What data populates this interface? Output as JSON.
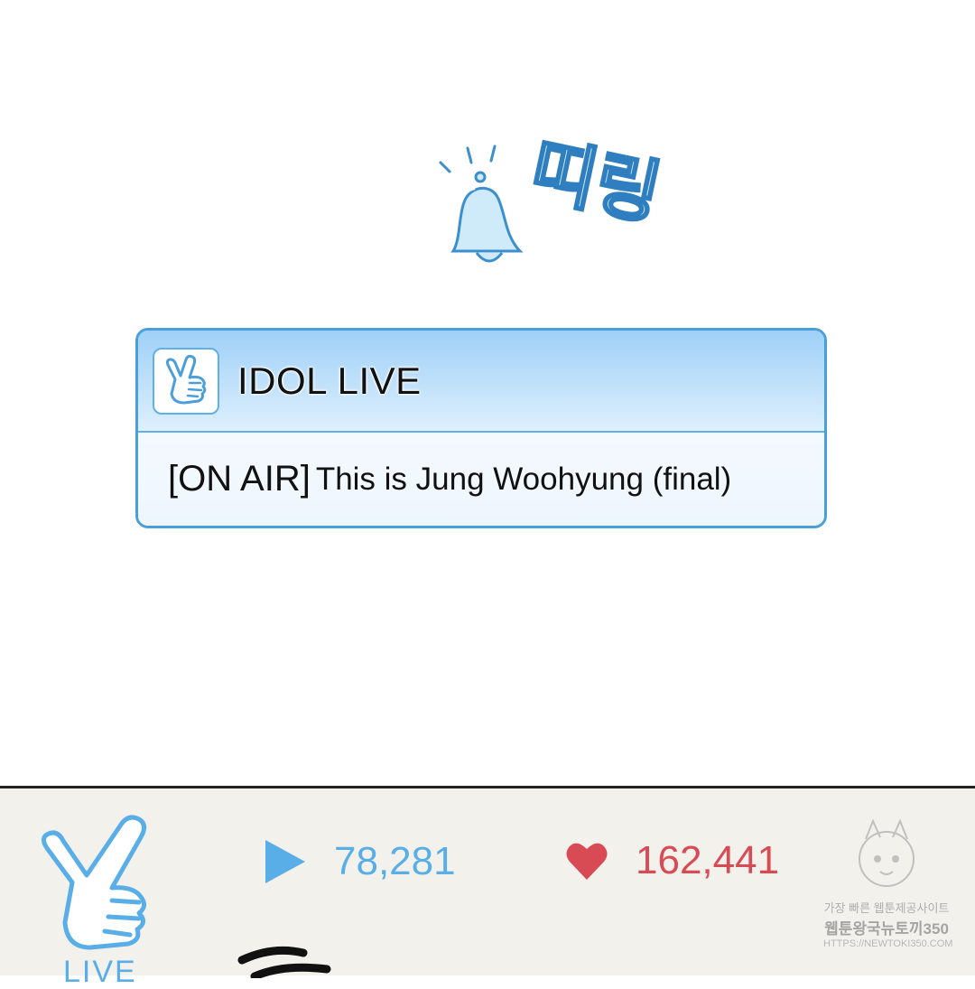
{
  "sound_effect": {
    "text": "띠링",
    "icon": "bell-icon"
  },
  "notification": {
    "app_icon": "hand-gesture-icon",
    "app_name": "IDOL LIVE",
    "tag": "[ON AIR]",
    "message": "This is Jung Woohyung (final)"
  },
  "bottom_bar": {
    "live_icon": "hand-gesture-icon",
    "live_label": "LIVE",
    "views_icon": "play-icon",
    "views": "78,281",
    "likes_icon": "heart-icon",
    "likes": "162,441"
  },
  "watermark": {
    "line1": "가장 빠른 웹툰제공사이트",
    "line2": "웹툰왕국뉴토끼350",
    "line3": "HTTPS://NEWTOKI350.COM"
  },
  "colors": {
    "accent_blue": "#5aaee8",
    "border_blue": "#4a9fd8",
    "likes_red": "#d84a54"
  }
}
